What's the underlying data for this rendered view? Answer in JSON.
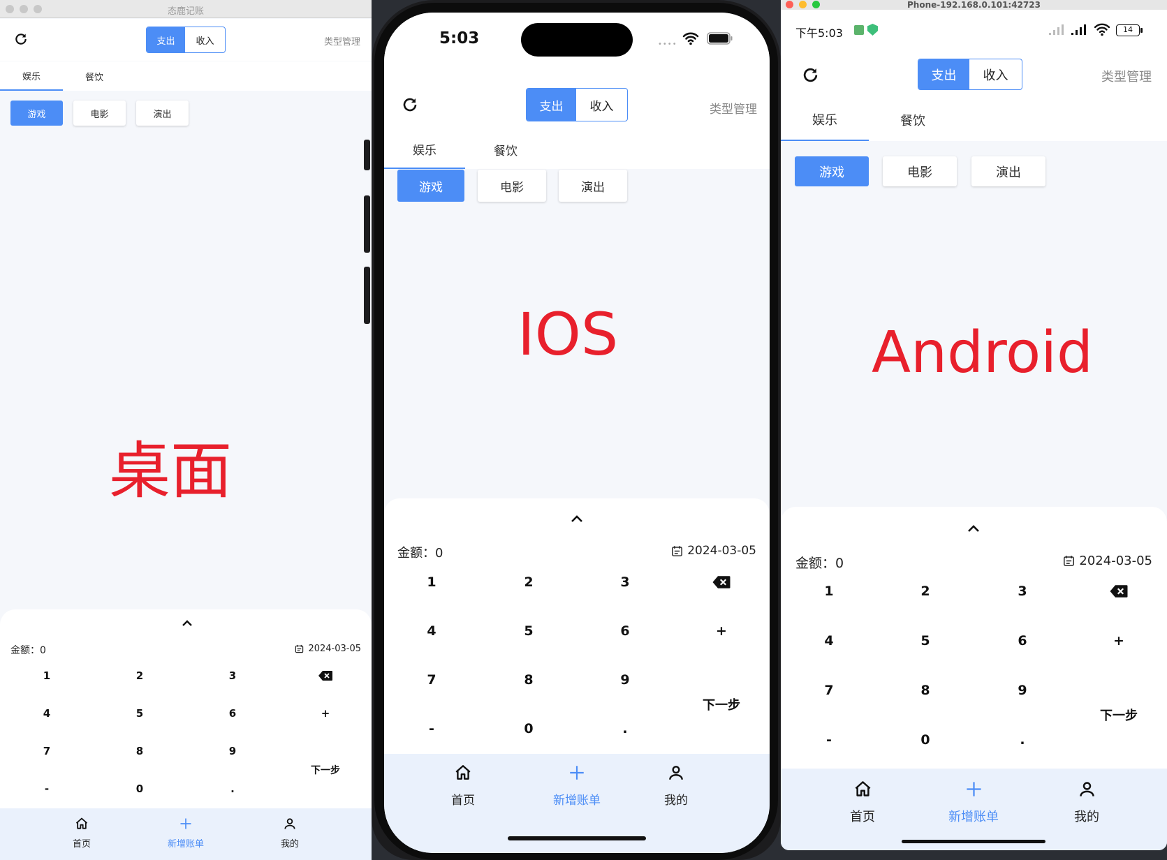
{
  "desktop": {
    "window_title": "态鹿记账",
    "label": "桌面"
  },
  "ios": {
    "time": "5:03",
    "label": "IOS"
  },
  "android": {
    "window_title": "Phone-192.168.0.101:42723",
    "status_time": "下午5:03",
    "battery": "14",
    "label": "Android"
  },
  "app": {
    "segment": {
      "expense": "支出",
      "income": "收入"
    },
    "type_manage": "类型管理",
    "tabs": [
      "娱乐",
      "餐饮"
    ],
    "chips": [
      "游戏",
      "电影",
      "演出"
    ],
    "amount": "金额：0",
    "date": "2024-03-05",
    "keys": [
      "1",
      "2",
      "3",
      "4",
      "5",
      "6",
      "7",
      "8",
      "9",
      "-",
      "0",
      "."
    ],
    "plus": "+",
    "next": "下一步",
    "nav": [
      "首页",
      "新增账单",
      "我的"
    ]
  },
  "colors": {
    "accent": "#4c8df6",
    "label_red": "#e8202c",
    "bg": "#f5f7fb",
    "nav_bg": "#eaf1fc"
  },
  "icons": [
    "refresh-icon",
    "chevron-up-icon",
    "calendar-icon",
    "backspace-icon",
    "home-icon",
    "plus-icon",
    "user-icon",
    "wifi-icon",
    "signal-icon",
    "battery-icon"
  ]
}
